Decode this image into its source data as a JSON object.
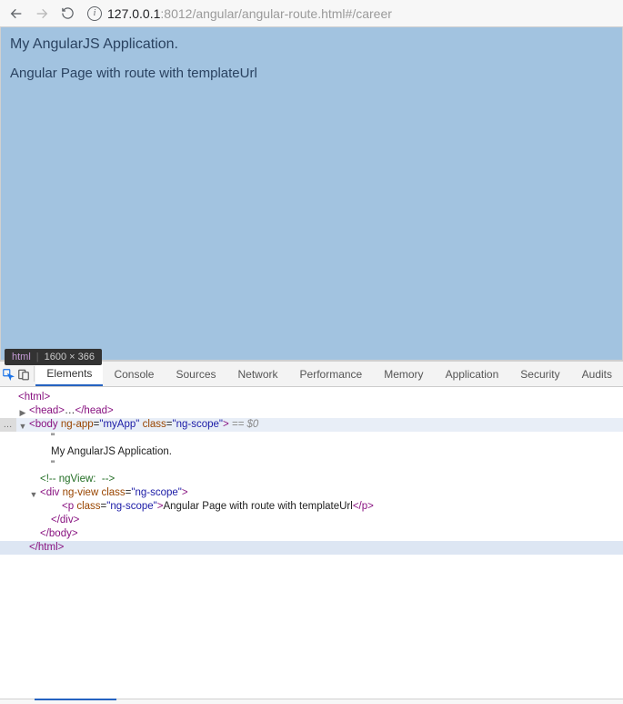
{
  "chrome": {
    "url_host": "127.0.0.1",
    "url_port": ":8012",
    "url_path": "/angular/angular-route.html#/career"
  },
  "page": {
    "title": "My AngularJS Application.",
    "subtitle": "Angular Page with route with templateUrl"
  },
  "tooltip": {
    "tag": "html",
    "dims": "1600 × 366"
  },
  "devtools": {
    "tabs": [
      "Elements",
      "Console",
      "Sources",
      "Network",
      "Performance",
      "Memory",
      "Application",
      "Security",
      "Audits"
    ]
  },
  "dom": {
    "l0": "<html>",
    "l1a": "<head>",
    "l1b": "…",
    "l1c": "</head>",
    "l2a": "<body ",
    "l2attr1": "ng-app",
    "l2val1": "\"myApp\"",
    "l2attr2": "class",
    "l2val2": "\"ng-scope\"",
    "l2end": ">",
    "l2meta": " == $0",
    "l3": "\"",
    "l4": "My AngularJS Application.",
    "l5": "\"",
    "l6": "<!-- ngView:  -->",
    "l7a": "<div ",
    "l7attr1": "ng-view",
    "l7attr2": "class",
    "l7val2": "\"ng-scope\"",
    "l7end": ">",
    "l8a": "<p ",
    "l8attr": "class",
    "l8val": "\"ng-scope\"",
    "l8mid": ">",
    "l8txt": "Angular Page with route with templateUrl",
    "l8close": "</p>",
    "l9": "</div>",
    "l10": "</body>",
    "l11": "</html>"
  }
}
